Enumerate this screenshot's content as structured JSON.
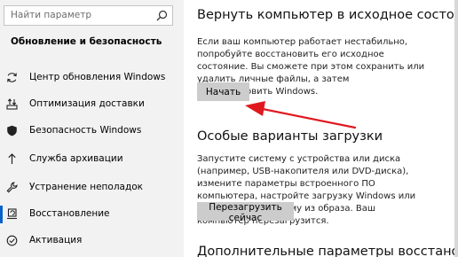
{
  "sidebar": {
    "search_placeholder": "Найти параметр",
    "section_title": "Обновление и безопасность",
    "items": [
      {
        "label": "Центр обновления Windows",
        "icon": "sync-icon"
      },
      {
        "label": "Оптимизация доставки",
        "icon": "delivery-optimization-icon"
      },
      {
        "label": "Безопасность Windows",
        "icon": "shield-icon"
      },
      {
        "label": "Служба архивации",
        "icon": "backup-arrow-icon"
      },
      {
        "label": "Устранение неполадок",
        "icon": "wrench-icon"
      },
      {
        "label": "Восстановление",
        "icon": "recovery-icon",
        "selected": true
      },
      {
        "label": "Активация",
        "icon": "activation-check-icon"
      }
    ]
  },
  "content": {
    "reset_title": "Вернуть компьютер в исходное состояние",
    "reset_text": "Если ваш компьютер работает нестабильно, попробуйте восстановить его исходное состояние. Вы сможете при этом сохранить или удалить личные файлы, а затем переустановить Windows.",
    "reset_button": "Начать",
    "boot_title": "Особые варианты загрузки",
    "boot_text": "Запустите систему с устройства или диска (например, USB-накопителя или DVD-диска), измените параметры встроенного ПО компьютера, настройте загрузку Windows или восстановите систему из образа. Ваш компьютер перезагрузится.",
    "restart_button": "Перезагрузить сейчас",
    "more_title": "Дополнительные параметры восстановления"
  },
  "colors": {
    "accent": "#0a63c9",
    "annotation_arrow": "#e0191f",
    "sidebar_bg": "#f2f2f2",
    "button_bg": "#cccccc"
  }
}
